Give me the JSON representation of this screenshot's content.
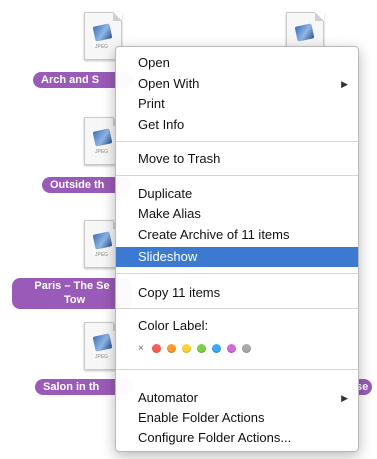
{
  "desktop": {
    "files": [
      {
        "label": "Arch and S"
      },
      {
        "label": "Outside th"
      },
      {
        "label": "Paris – The Se",
        "label_line2": "Tow"
      },
      {
        "label": "Salon in th"
      }
    ],
    "right_edge_fragment": "se",
    "doc_tag": "JPEG"
  },
  "context_menu": {
    "groups": [
      [
        {
          "label": "Open"
        },
        {
          "label": "Open With",
          "submenu": true
        },
        {
          "label": "Print"
        },
        {
          "label": "Get Info"
        }
      ],
      [
        {
          "label": "Move to Trash"
        }
      ],
      [
        {
          "label": "Duplicate"
        },
        {
          "label": "Make Alias"
        },
        {
          "label": "Create Archive of 11 items"
        },
        {
          "label": "Slideshow",
          "selected": true
        }
      ],
      [
        {
          "label": "Copy 11 items"
        }
      ],
      [
        {
          "label": "Color Label:"
        }
      ],
      [
        {
          "label": "Automator",
          "submenu": true
        },
        {
          "label": "Enable Folder Actions"
        },
        {
          "label": "Configure Folder Actions..."
        }
      ]
    ],
    "color_labels": {
      "none_symbol": "×",
      "colors": [
        "#ff5a5a",
        "#ff9a2e",
        "#ffd23a",
        "#7ed044",
        "#3ea7ff",
        "#d36bd8",
        "#a9a9a9"
      ]
    },
    "submenu_glyph": "▶",
    "selection_color": "#3b7ad0"
  }
}
